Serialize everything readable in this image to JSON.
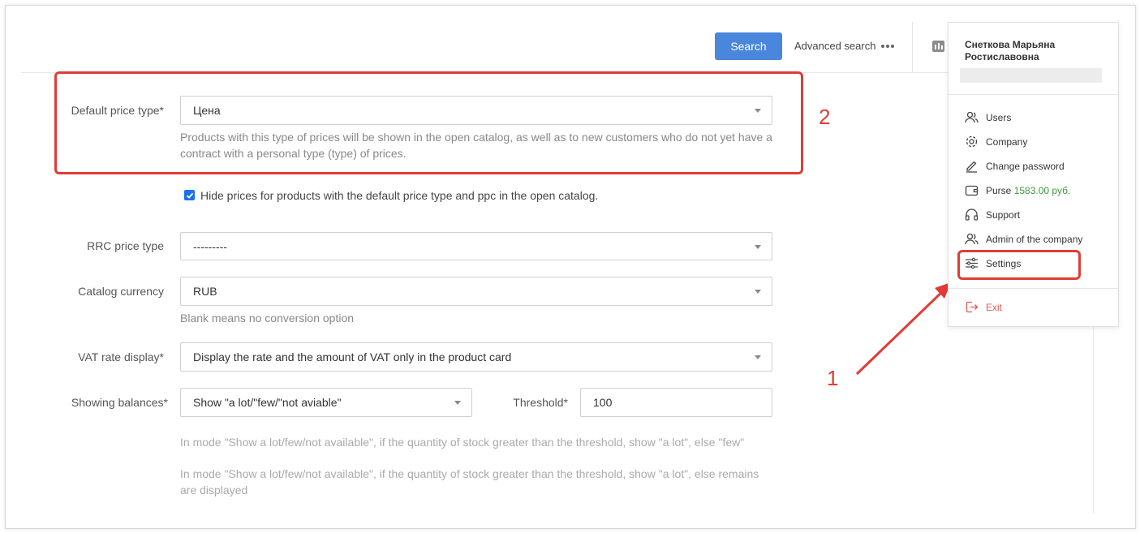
{
  "header": {
    "search_label": "Search",
    "advanced_search_label": "Advanced search"
  },
  "form": {
    "default_price_type": {
      "label": "Default price type*",
      "value": "Цена",
      "help": "Products with this type of prices will be shown in the open catalog, as well as to new customers who do not yet have a contract with a personal type (type) of prices."
    },
    "hide_prices": {
      "checked": true,
      "label": "Hide prices for products with the default price type and ppc in the open catalog."
    },
    "rrc_price_type": {
      "label": "RRC price type",
      "value": "---------"
    },
    "catalog_currency": {
      "label": "Catalog currency",
      "value": "RUB",
      "help": "Blank means no conversion option"
    },
    "vat_rate_display": {
      "label": "VAT rate display*",
      "value": "Display the rate and the amount of VAT only in the product card"
    },
    "showing_balances": {
      "label": "Showing balances*",
      "value": "Show \"a lot/\"few/\"not aviable\""
    },
    "threshold": {
      "label": "Threshold*",
      "value": "100"
    },
    "balances_help_1": "In mode \"Show a lot/few/not available\", if the quantity of stock greater than the threshold, show \"a lot\", else \"few\"",
    "balances_help_2": "In mode \"Show a lot/few/not available\", if the quantity of stock greater than the threshold, show \"a lot\", else remains are displayed"
  },
  "user_menu": {
    "name_line1": "Снеткова Марьяна",
    "name_line2": "Ростиславовна",
    "items": [
      {
        "label": "Users",
        "icon": "users-icon"
      },
      {
        "label": "Company",
        "icon": "gear-icon"
      },
      {
        "label": "Change password",
        "icon": "pencil-icon"
      },
      {
        "label": "Purse",
        "value": "1583.00 руб.",
        "icon": "wallet-icon"
      },
      {
        "label": "Support",
        "icon": "headphones-icon"
      },
      {
        "label": "Admin of the company",
        "icon": "users-icon"
      },
      {
        "label": "Settings",
        "icon": "sliders-icon"
      }
    ],
    "exit_label": "Exit"
  },
  "annotations": {
    "marker_1": "1",
    "marker_2": "2",
    "accent_color": "#e03c35"
  }
}
